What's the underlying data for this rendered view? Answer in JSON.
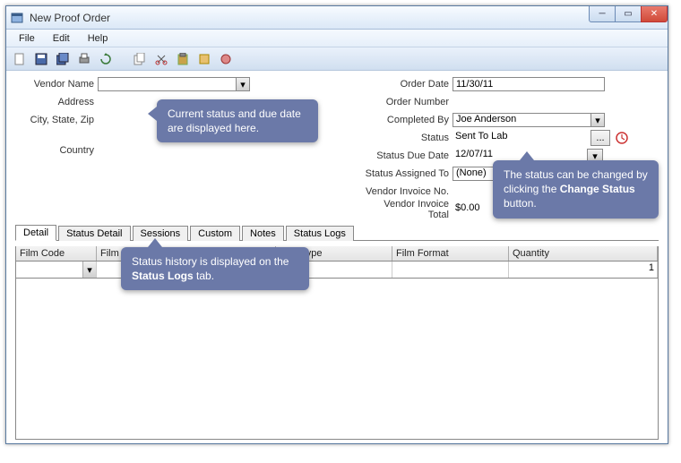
{
  "window": {
    "title": "New Proof Order"
  },
  "menu": {
    "file": "File",
    "edit": "Edit",
    "help": "Help"
  },
  "form": {
    "left_labels": {
      "vendor_name": "Vendor Name",
      "address": "Address",
      "city_state_zip": "City, State, Zip",
      "country": "Country"
    },
    "right_labels": {
      "order_date": "Order Date",
      "order_number": "Order Number",
      "completed_by": "Completed By",
      "status": "Status",
      "status_due": "Status Due Date",
      "status_assigned": "Status Assigned To",
      "vendor_inv_no": "Vendor Invoice No.",
      "vendor_inv_total": "Vendor Invoice Total"
    },
    "values": {
      "order_date": "11/30/11",
      "completed_by": "Joe Anderson",
      "status": "Sent To Lab",
      "status_due": "12/07/11",
      "status_assigned": "(None)",
      "vendor_inv_total": "$0.00"
    },
    "change_status_btn": "..."
  },
  "tabs": {
    "detail": "Detail",
    "status_detail": "Status Detail",
    "sessions": "Sessions",
    "custom": "Custom",
    "notes": "Notes",
    "status_logs": "Status Logs"
  },
  "grid": {
    "headers": {
      "film_code": "Film Code",
      "film_desc": "Film Description",
      "film_type": "Film Type",
      "film_format": "Film Format",
      "quantity": "Quantity"
    },
    "row": {
      "quantity": "1"
    }
  },
  "callouts": {
    "c1": "Current status and due date are displayed here.",
    "c2a": "The status can be changed by clicking the ",
    "c2b": "Change Status",
    "c2c": " button.",
    "c3a": "Status history is displayed on the ",
    "c3b": "Status Logs",
    "c3c": " tab."
  }
}
